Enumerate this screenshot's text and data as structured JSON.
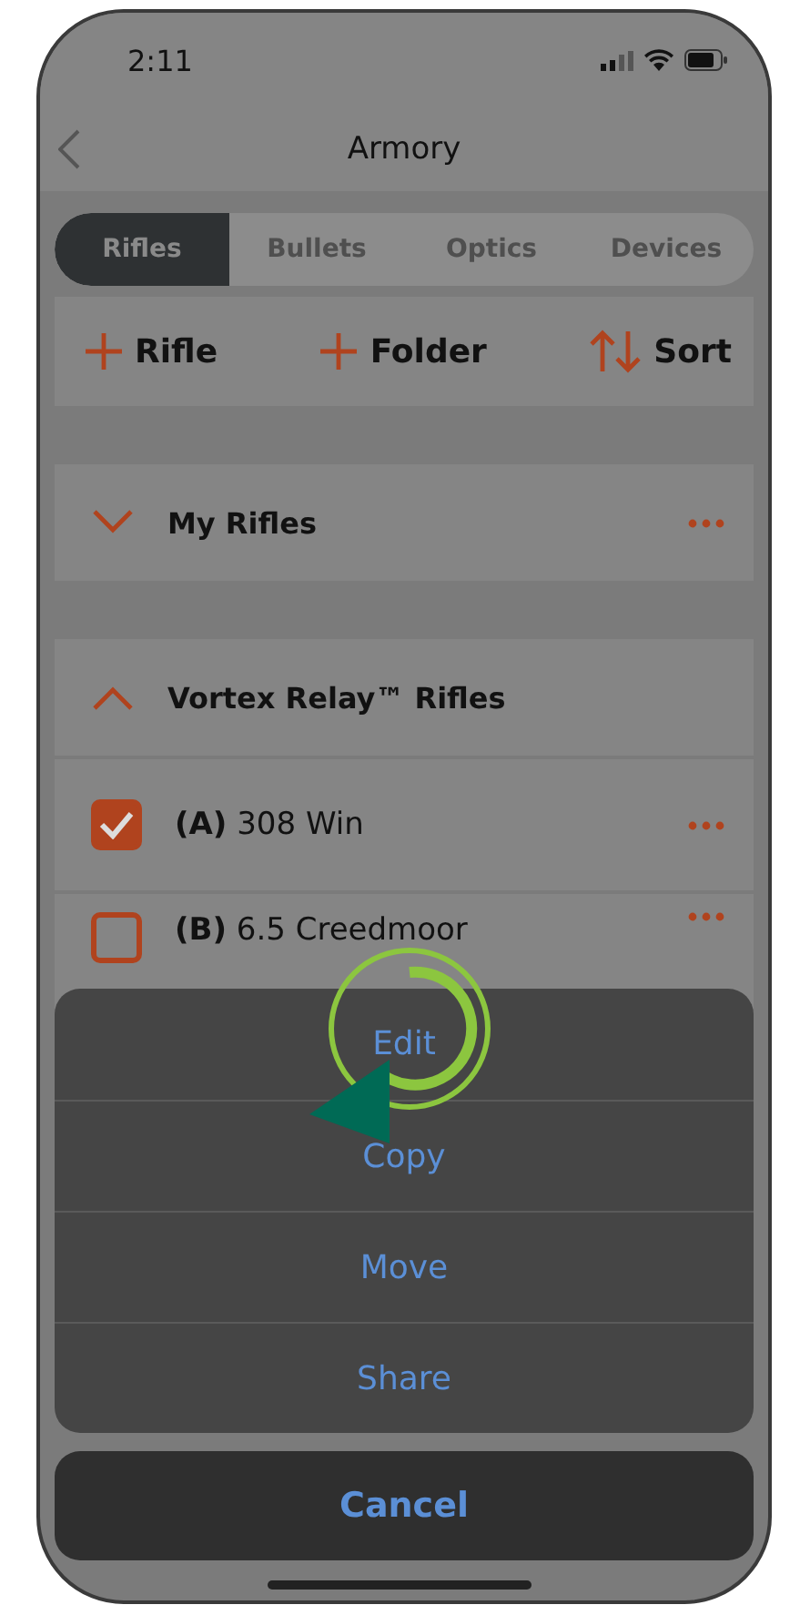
{
  "status_bar": {
    "time": "2:11"
  },
  "nav": {
    "title": "Armory"
  },
  "tabs": [
    {
      "label": "Rifles",
      "selected": true
    },
    {
      "label": "Bullets",
      "selected": false
    },
    {
      "label": "Optics",
      "selected": false
    },
    {
      "label": "Devices",
      "selected": false
    }
  ],
  "actions": [
    {
      "kind": "add",
      "label": "Rifle"
    },
    {
      "kind": "add",
      "label": "Folder"
    },
    {
      "kind": "sort",
      "label": "Sort"
    }
  ],
  "groups": [
    {
      "title": "My Rifles",
      "expanded": false
    },
    {
      "title": "Vortex Relay™ Rifles",
      "expanded": true,
      "items": [
        {
          "label": "**(A)** 308 Win",
          "checked": true
        },
        {
          "label": "**(B)** 6.5 Creedmoor",
          "checked": false
        }
      ]
    }
  ],
  "action_sheet": {
    "options": [
      "Edit",
      "Copy",
      "Move",
      "Share"
    ],
    "cancel": "Cancel"
  }
}
